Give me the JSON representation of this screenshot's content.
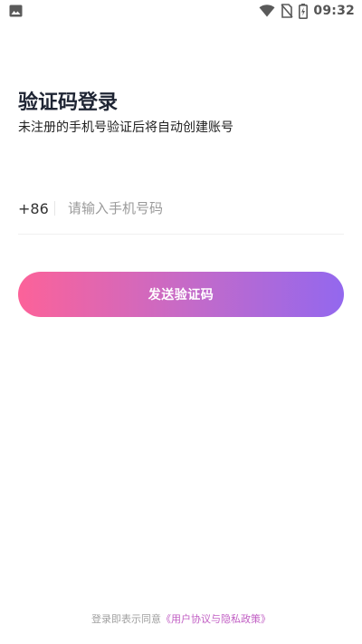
{
  "status_bar": {
    "time": "09:32",
    "left_icon": "image-icon",
    "right_icons": [
      "wifi-icon",
      "no-sim-icon",
      "battery-charging-icon"
    ]
  },
  "login": {
    "title": "验证码登录",
    "subtitle": "未注册的手机号验证后将自动创建账号",
    "country_code": "+86",
    "phone_placeholder": "请输入手机号码",
    "phone_value": "",
    "send_button_label": "发送验证码"
  },
  "footer": {
    "agreement_prefix": "登录即表示同意",
    "agreement_link": "《用户协议与隐私政策》"
  },
  "colors": {
    "button_gradient_start": "#fc6299",
    "button_gradient_end": "#9368ee",
    "link": "#c15fc4",
    "title": "#1e2433"
  }
}
